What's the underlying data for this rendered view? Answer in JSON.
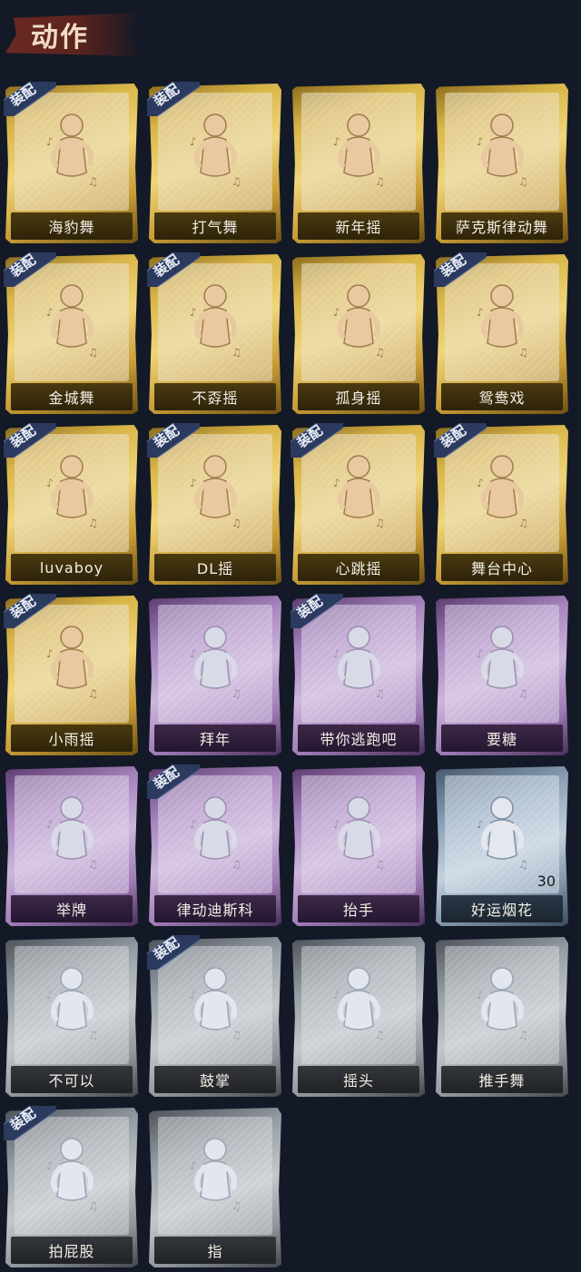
{
  "header": {
    "title": "动作"
  },
  "equip_label": "装配",
  "colors": {
    "gold": "#d9b548",
    "purple": "#a886bf",
    "blue": "#8fa3b8",
    "grey": "#9aa0a8",
    "equip_ribbon": "#2b3a5e"
  },
  "items": [
    {
      "name": "海豹舞",
      "rarity": "gold",
      "equipped": true,
      "icon": "seal-dance-pose-icon"
    },
    {
      "name": "打气舞",
      "rarity": "gold",
      "equipped": true,
      "icon": "cheer-dance-pose-icon"
    },
    {
      "name": "新年摇",
      "rarity": "gold",
      "equipped": false,
      "icon": "new-year-shake-pose-icon"
    },
    {
      "name": "萨克斯律动舞",
      "rarity": "gold",
      "equipped": false,
      "icon": "sax-groove-pose-icon"
    },
    {
      "name": "金城舞",
      "rarity": "gold",
      "equipped": true,
      "icon": "jincheng-dance-pose-icon"
    },
    {
      "name": "不孬摇",
      "rarity": "gold",
      "equipped": true,
      "icon": "bunao-shake-pose-icon"
    },
    {
      "name": "孤身摇",
      "rarity": "gold",
      "equipped": false,
      "icon": "solo-shake-pose-icon"
    },
    {
      "name": "鸳鸯戏",
      "rarity": "gold",
      "equipped": true,
      "icon": "mandarin-duck-pose-icon"
    },
    {
      "name": "luvaboy",
      "rarity": "gold",
      "equipped": true,
      "icon": "luvaboy-pose-icon"
    },
    {
      "name": "DL摇",
      "rarity": "gold",
      "equipped": true,
      "icon": "dl-shake-pose-icon"
    },
    {
      "name": "心跳摇",
      "rarity": "gold",
      "equipped": true,
      "icon": "heartbeat-shake-pose-icon"
    },
    {
      "name": "舞台中心",
      "rarity": "gold",
      "equipped": true,
      "icon": "center-stage-pose-icon"
    },
    {
      "name": "小雨摇",
      "rarity": "gold",
      "equipped": true,
      "icon": "light-rain-shake-pose-icon"
    },
    {
      "name": "拜年",
      "rarity": "purple",
      "equipped": false,
      "icon": "new-year-greeting-pose-icon"
    },
    {
      "name": "带你逃跑吧",
      "rarity": "purple",
      "equipped": true,
      "icon": "run-away-pose-icon"
    },
    {
      "name": "要糖",
      "rarity": "purple",
      "equipped": false,
      "icon": "ask-candy-pose-icon"
    },
    {
      "name": "举牌",
      "rarity": "purple",
      "equipped": false,
      "icon": "hold-sign-pose-icon"
    },
    {
      "name": "律动迪斯科",
      "rarity": "purple",
      "equipped": true,
      "icon": "groove-disco-pose-icon"
    },
    {
      "name": "抬手",
      "rarity": "purple",
      "equipped": false,
      "icon": "raise-hand-pose-icon"
    },
    {
      "name": "好运烟花",
      "rarity": "blue",
      "equipped": false,
      "icon": "firework-icon",
      "count": "30"
    },
    {
      "name": "不可以",
      "rarity": "grey",
      "equipped": false,
      "icon": "finger-wag-icon"
    },
    {
      "name": "鼓掌",
      "rarity": "grey",
      "equipped": true,
      "icon": "clap-hands-icon"
    },
    {
      "name": "摇头",
      "rarity": "grey",
      "equipped": false,
      "icon": "shake-head-pose-icon"
    },
    {
      "name": "推手舞",
      "rarity": "grey",
      "equipped": false,
      "icon": "push-hand-dance-pose-icon"
    },
    {
      "name": "拍屁股",
      "rarity": "grey",
      "equipped": true,
      "icon": "slap-butt-pose-icon"
    },
    {
      "name": "指",
      "rarity": "grey",
      "equipped": false,
      "icon": "point-finger-icon"
    }
  ]
}
